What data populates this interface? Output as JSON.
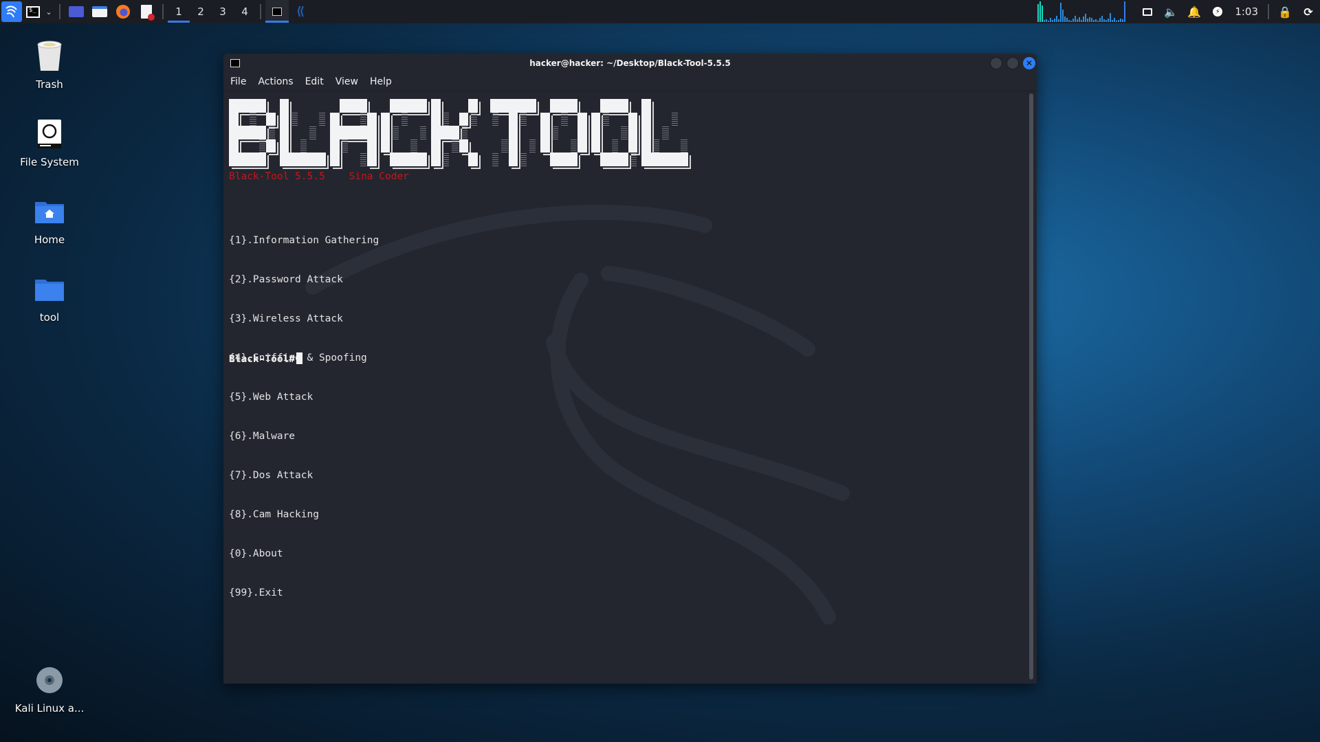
{
  "taskbar": {
    "workspaces": [
      "1",
      "2",
      "3",
      "4"
    ],
    "active_workspace": "1",
    "launchers": [
      "kali-menu",
      "terminal",
      "show-desktop",
      "file-manager",
      "firefox",
      "text-editor"
    ],
    "tasks": [
      "terminal-window",
      "vscode"
    ],
    "clock": "1:03"
  },
  "desktop": {
    "icons": [
      {
        "label": "Trash"
      },
      {
        "label": "File System"
      },
      {
        "label": "Home"
      },
      {
        "label": "tool"
      },
      {
        "label": "Kali Linux a..."
      }
    ]
  },
  "window": {
    "title": "hacker@hacker: ~/Desktop/Black-Tool-5.5.5",
    "menu": [
      "File",
      "Actions",
      "Edit",
      "View",
      "Help"
    ]
  },
  "terminal": {
    "banner_letters": "BLACKTOOL",
    "subtitle_left": "Black-Tool 5.5.5",
    "subtitle_right": "Sina Coder",
    "menu_items": [
      "{1}.Information Gathering",
      "{2}.Password Attack",
      "{3}.Wireless Attack",
      "{4}.Sniffing & Spoofing",
      "{5}.Web Attack",
      "{6}.Malware",
      "{7}.Dos Attack",
      "{8}.Cam Hacking",
      "{0}.About",
      "{99}.Exit"
    ],
    "prompt": "Black-Tool#"
  },
  "colors": {
    "accent": "#2f7df6",
    "subtitle_red": "#c5161b",
    "terminal_bg": "#23262f"
  }
}
